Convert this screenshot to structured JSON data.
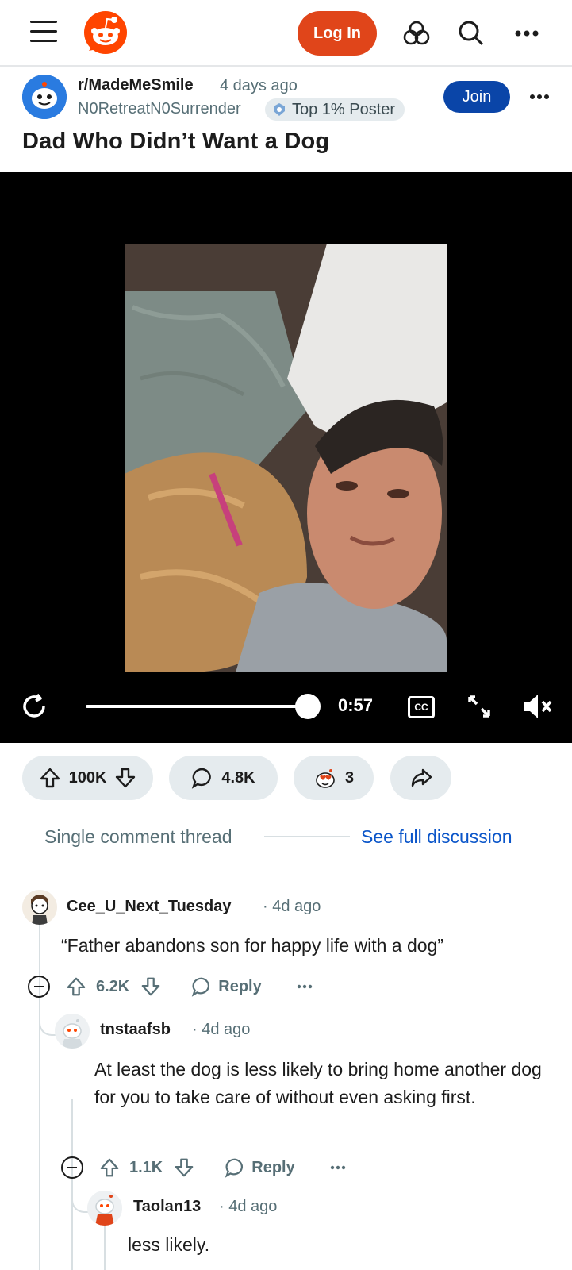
{
  "header": {
    "login_label": "Log In"
  },
  "post": {
    "subreddit": "r/MadeMeSmile",
    "time": "4 days ago",
    "author": "N0RetreatN0Surrender",
    "flair": "Top 1% Poster",
    "join_label": "Join",
    "title": "Dad Who Didn’t Want a Dog"
  },
  "video": {
    "time_remaining": "0:57",
    "cc_label": "CC",
    "progress": 0.96
  },
  "actions": {
    "votes": "100K",
    "comments": "4.8K",
    "awards": "3"
  },
  "thread": {
    "label": "Single comment thread",
    "full_link": "See full discussion"
  },
  "comments": [
    {
      "user": "Cee_U_Next_Tuesday",
      "time": "4d ago",
      "text": "“Father abandons son for happy life with a dog”",
      "votes": "6.2K",
      "reply_label": "Reply"
    },
    {
      "user": "tnstaafsb",
      "time": "4d ago",
      "text": "At least the dog is less likely to bring home another dog for you to take care of without even asking first.",
      "votes": "1.1K",
      "reply_label": "Reply"
    },
    {
      "user": "Taolan13",
      "time": "4d ago",
      "text": "less likely."
    }
  ],
  "colors": {
    "brand": "#e0451a",
    "join": "#0a45a8",
    "link": "#0a55c9",
    "pill": "#e5ebee"
  }
}
